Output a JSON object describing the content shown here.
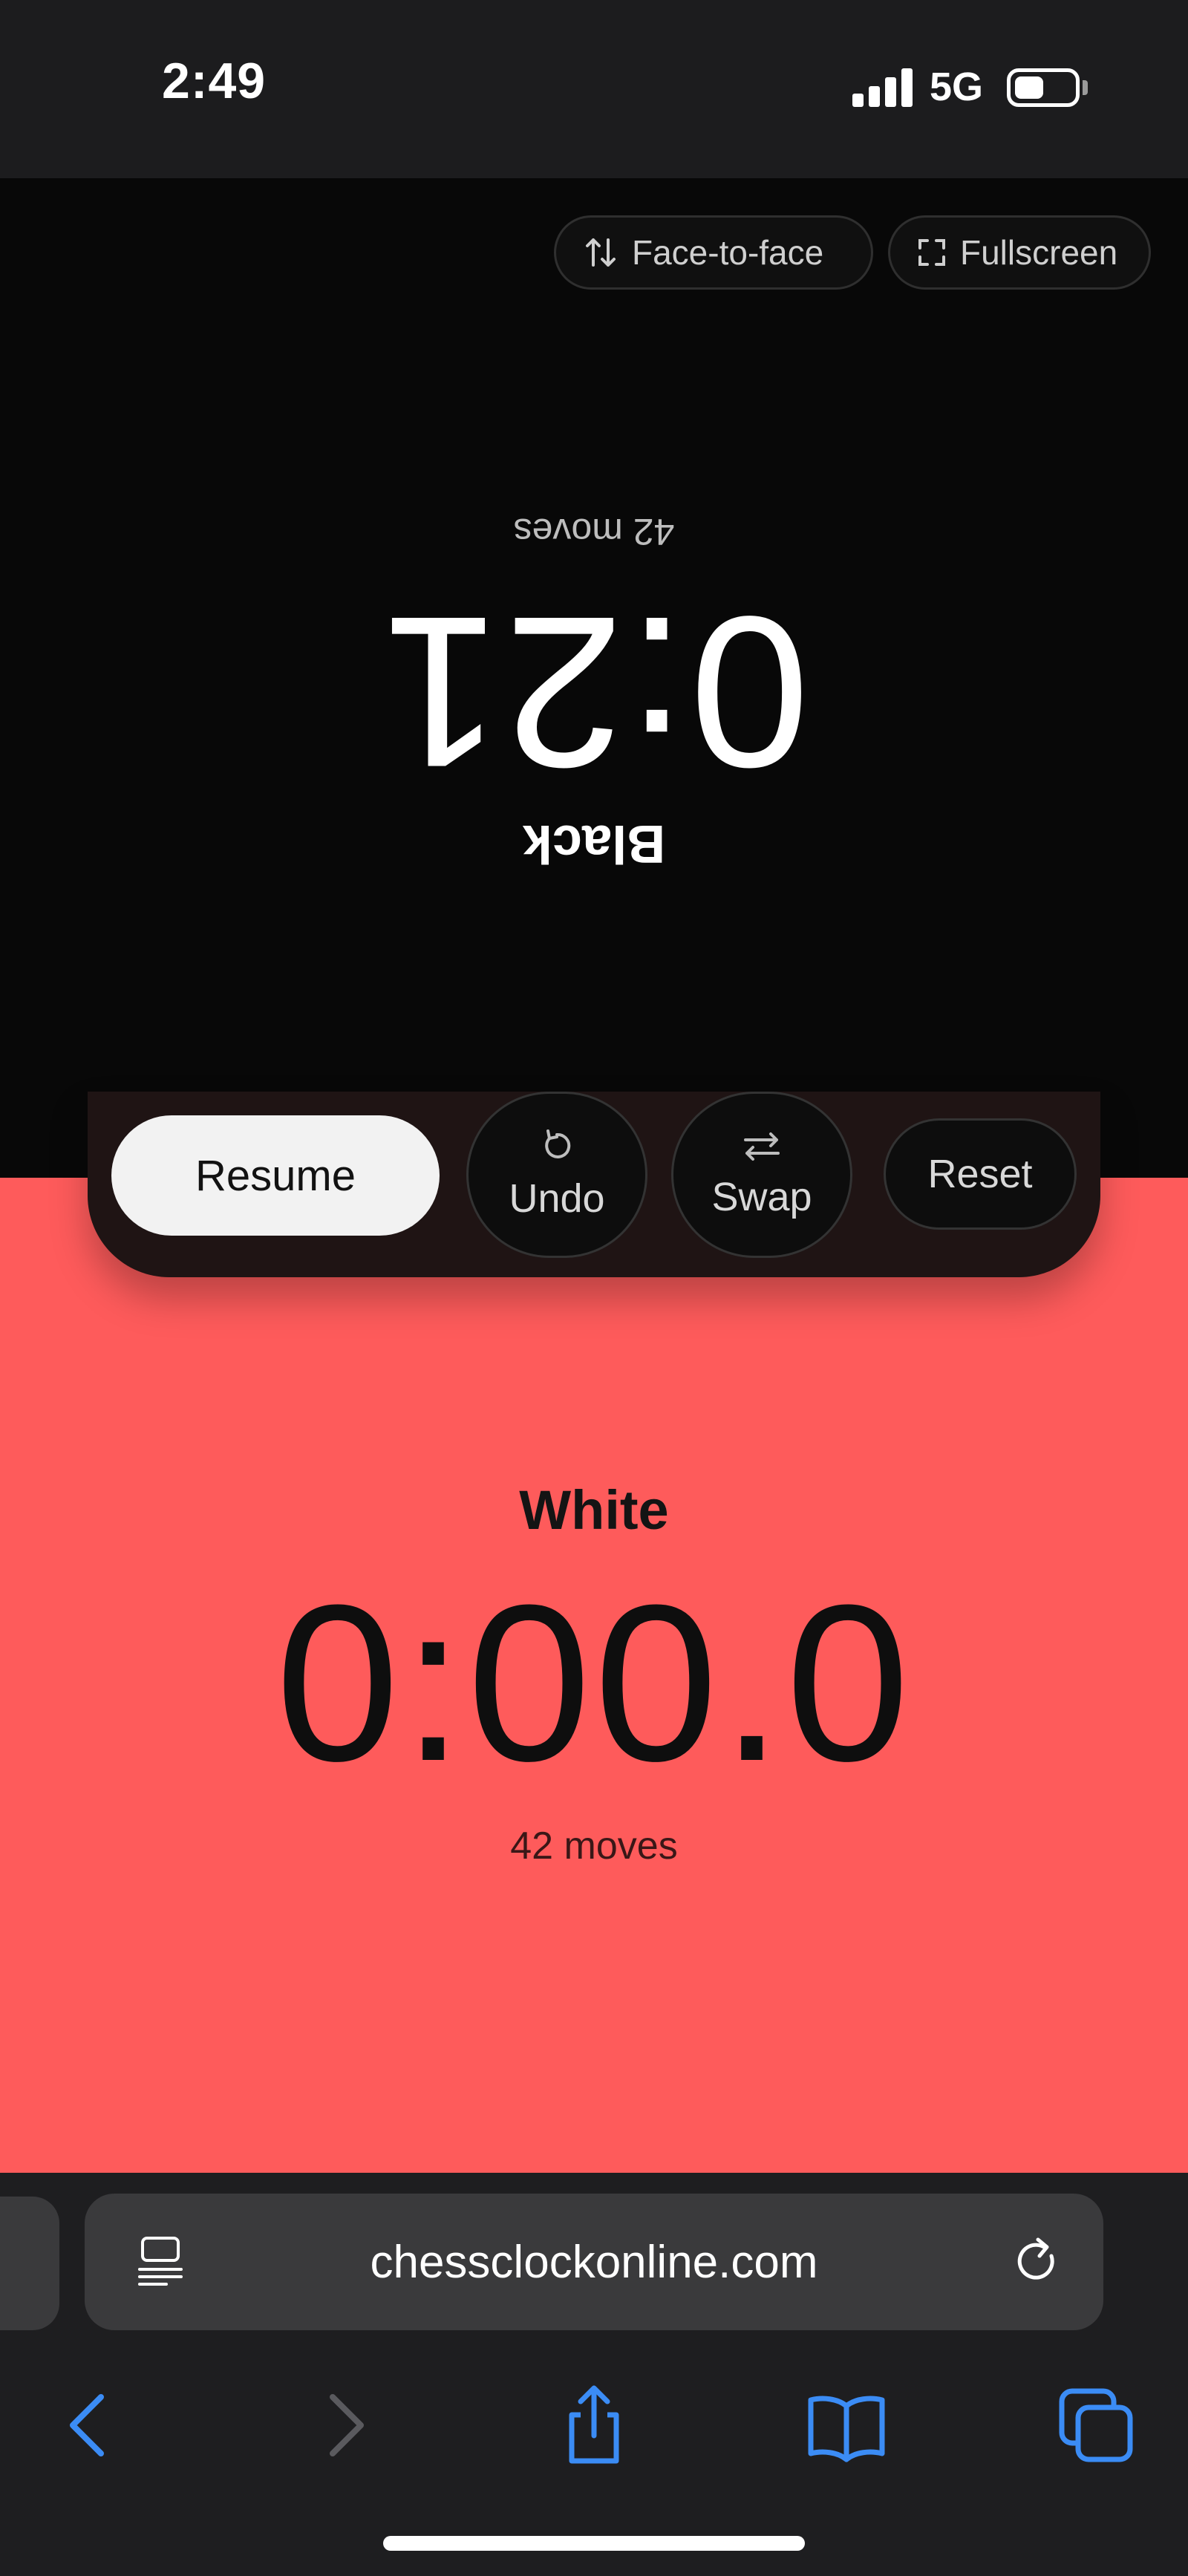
{
  "status_bar": {
    "time": "2:49",
    "network": "5G",
    "battery_level": 0.5,
    "icons": [
      "signal-icon",
      "battery-icon"
    ]
  },
  "top_actions": {
    "face_to_face": {
      "label": "Face-to-face",
      "icon": "swap-vertical-icon"
    },
    "fullscreen": {
      "label": "Fullscreen",
      "icon": "fullscreen-icon"
    }
  },
  "black_player": {
    "label": "Black",
    "time": "0:21",
    "moves": "42 moves"
  },
  "white_player": {
    "label": "White",
    "time": "0:00.0",
    "moves": "42 moves",
    "color": "#fe5b5b"
  },
  "controls": {
    "resume": "Resume",
    "undo": {
      "label": "Undo",
      "icon": "undo-icon"
    },
    "swap": {
      "label": "Swap",
      "icon": "swap-horizontal-icon"
    },
    "reset": "Reset"
  },
  "browser": {
    "url": "chessclockonline.com",
    "icons": [
      "reader-icon",
      "reload-icon",
      "back-icon",
      "forward-icon",
      "share-icon",
      "bookmarks-icon",
      "tabs-icon"
    ],
    "accent": "#3b8cf5"
  }
}
